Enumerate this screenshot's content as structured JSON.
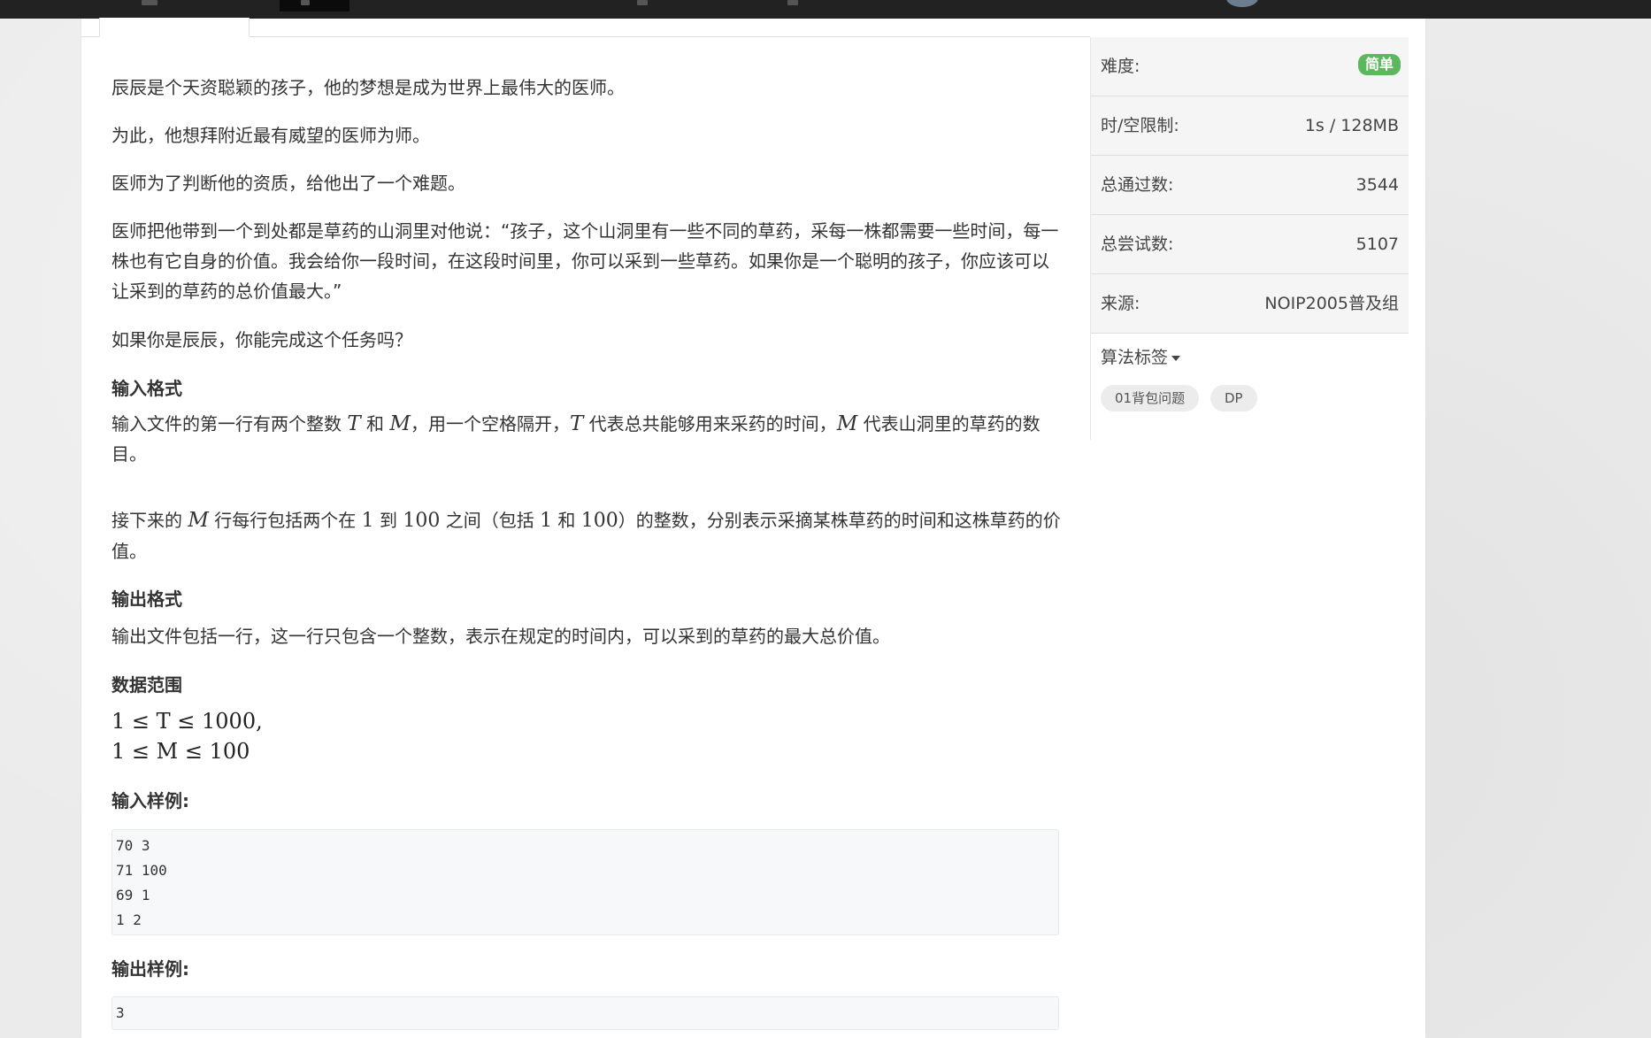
{
  "problem": {
    "intro": [
      "辰辰是个天资聪颖的孩子，他的梦想是成为世界上最伟大的医师。",
      "为此，他想拜附近最有威望的医师为师。",
      "医师为了判断他的资质，给他出了一个难题。",
      "医师把他带到一个到处都是草药的山洞里对他说：“孩子，这个山洞里有一些不同的草药，采每一株都需要一些时间，每一株也有它自身的价值。我会给你一段时间，在这段时间里，你可以采到一些草药。如果你是一个聪明的孩子，你应该可以让采到的草药的总价值最大。”",
      "如果你是辰辰，你能完成这个任务吗？"
    ],
    "input_format_heading": "输入格式",
    "input_p1": {
      "t1": "输入文件的第一行有两个整数 ",
      "m_T": "T",
      "t2": " 和 ",
      "m_M": "M",
      "t3": "，用一个空格隔开，",
      "m_T2": "T",
      "t4": " 代表总共能够用来采药的时间，",
      "m_M2": "M",
      "t5": " 代表山洞里的草药的数目。"
    },
    "input_p2": {
      "t1": "接下来的 ",
      "m_M": "M",
      "t2": " 行每行包括两个在 ",
      "n1": "1",
      "t3": " 到 ",
      "n100": "100",
      "t4": " 之间（包括 ",
      "n1b": "1",
      "t5": " 和 ",
      "n100b": "100",
      "t6": "）的整数，分别表示采摘某株草药的时间和这株草药的价值。"
    },
    "output_format_heading": "输出格式",
    "output_p": "输出文件包括一行，这一行只包含一个整数，表示在规定的时间内，可以采到的草药的最大总价值。",
    "data_range_heading": "数据范围",
    "range_lines": [
      "1 ≤ T ≤ 1000,",
      "1 ≤ M ≤ 100"
    ],
    "input_sample_heading": "输入样例:",
    "input_sample_lines": [
      "70 3",
      "71 100",
      "69 1",
      "1 2"
    ],
    "output_sample_heading": "输出样例:",
    "output_sample_lines": [
      "3"
    ]
  },
  "sidebar": {
    "difficulty_label": "难度:",
    "difficulty_value": "简单",
    "limit_label": "时/空限制:",
    "limit_value": "1s / 128MB",
    "passed_label": "总通过数:",
    "passed_value": "3544",
    "tried_label": "总尝试数:",
    "tried_value": "5107",
    "source_label": "来源:",
    "source_value": "NOIP2005普及组",
    "tags_label": "算法标签",
    "tags": [
      "01背包问题",
      "DP"
    ]
  },
  "colors": {
    "easy_badge": "#5cb85c",
    "topbar": "#222222",
    "page_bg": "#ececec"
  }
}
